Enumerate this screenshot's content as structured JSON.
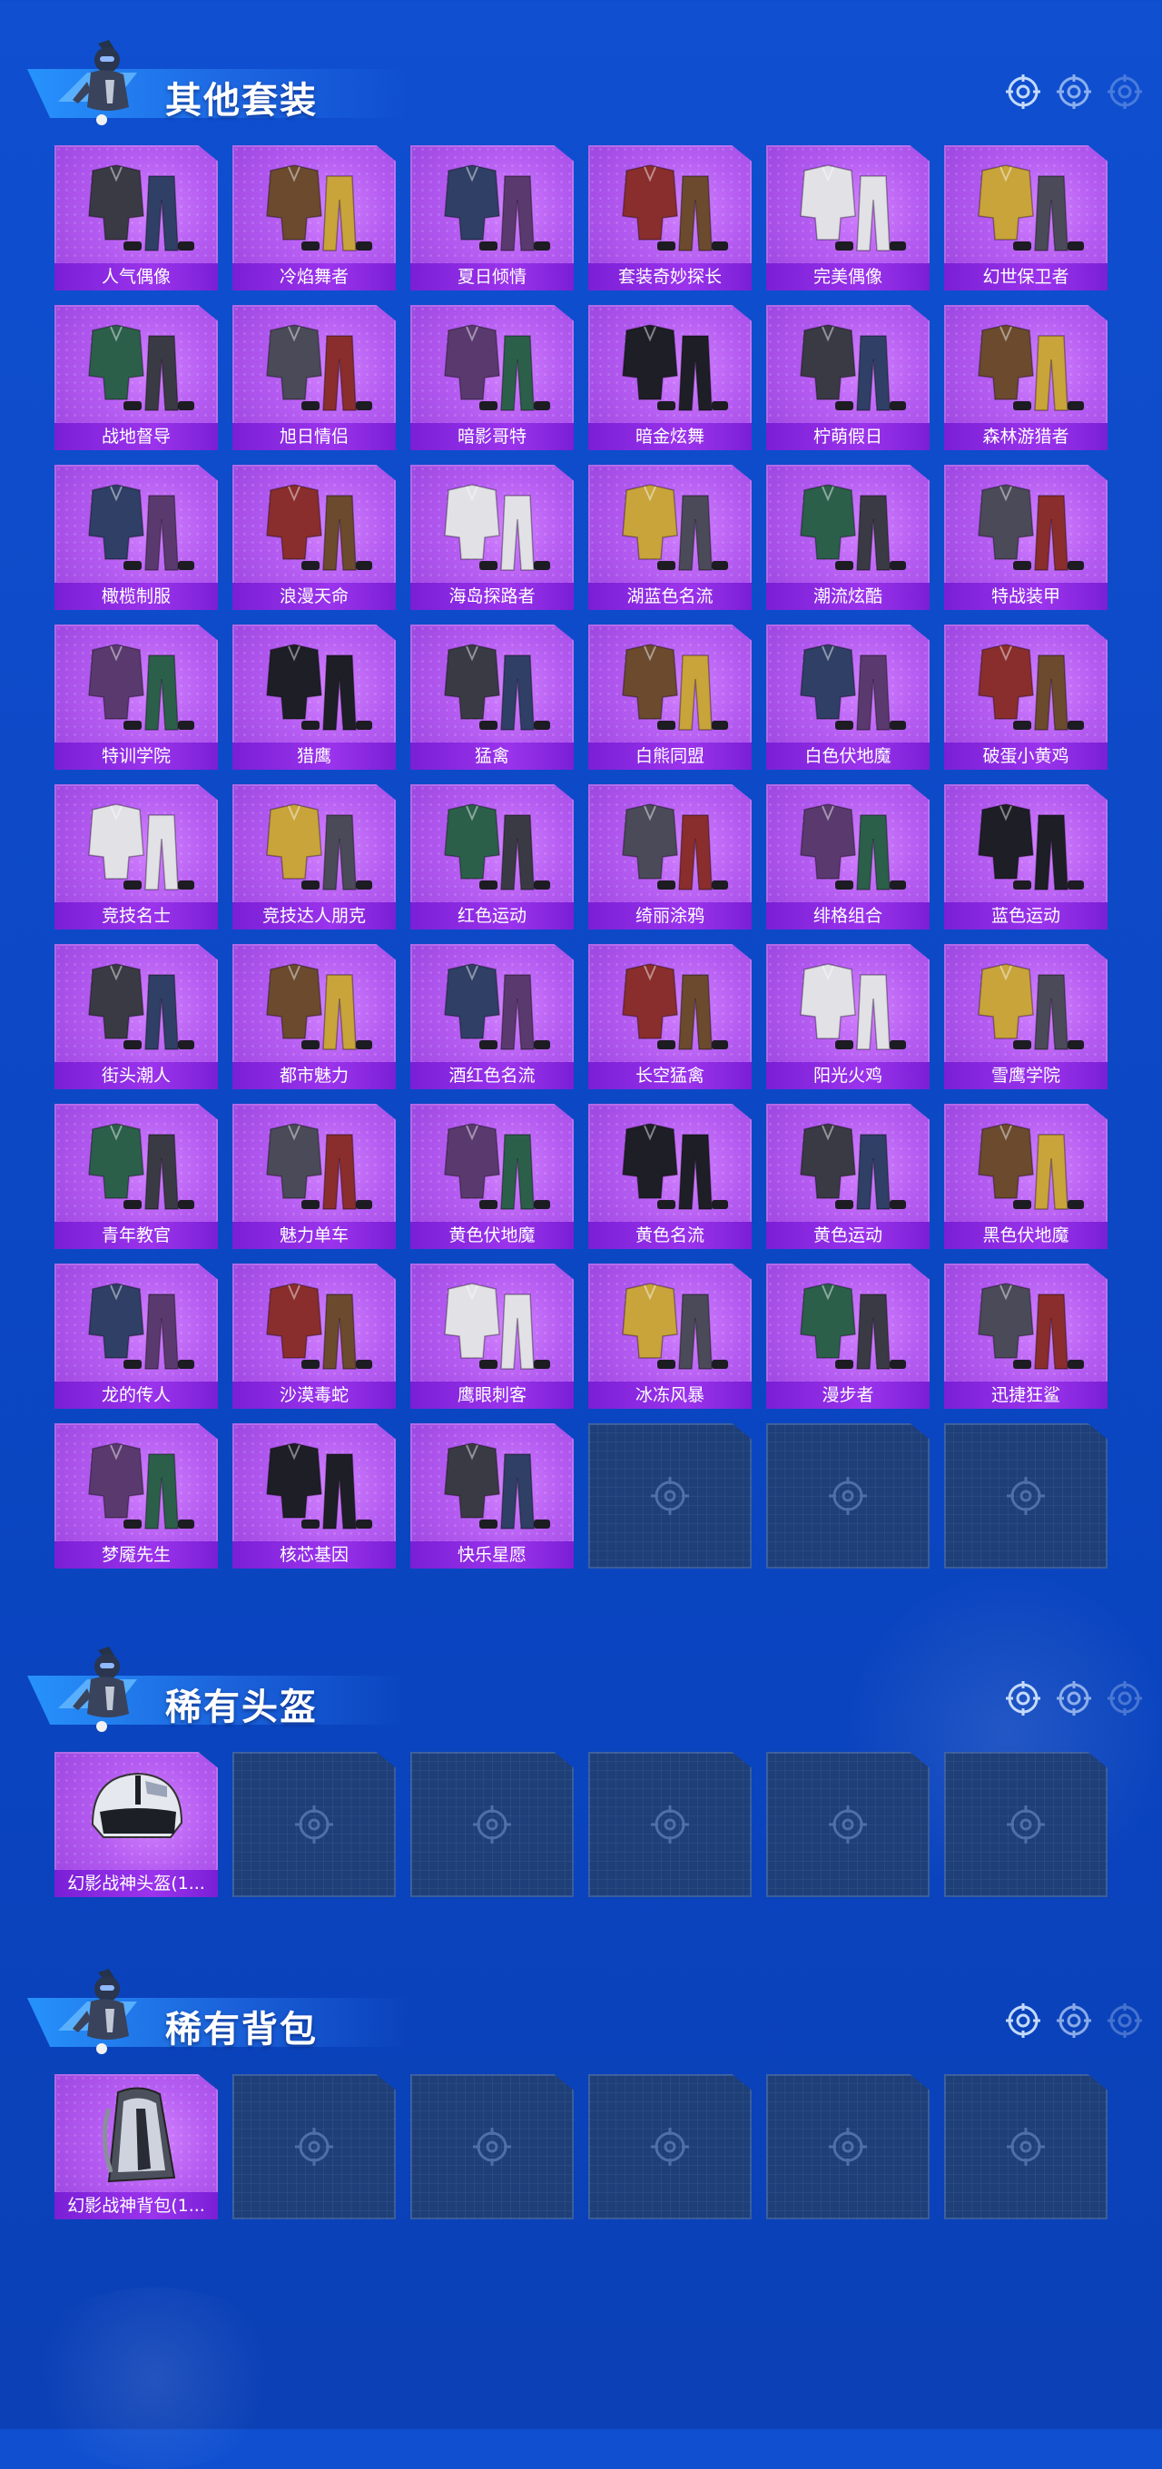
{
  "colors": {
    "page_bg": "#0d49c6",
    "card_bg": "#b45bf1",
    "label_bg": "#8a2ae3",
    "empty_bg": "#1e3f78"
  },
  "sections": [
    {
      "title": "其他套装",
      "items": [
        {
          "label": "人气偶像",
          "icon": "outfit"
        },
        {
          "label": "冷焰舞者",
          "icon": "outfit"
        },
        {
          "label": "夏日倾情",
          "icon": "outfit"
        },
        {
          "label": "套装奇妙探长",
          "icon": "outfit"
        },
        {
          "label": "完美偶像",
          "icon": "outfit"
        },
        {
          "label": "幻世保卫者",
          "icon": "outfit"
        },
        {
          "label": "战地督导",
          "icon": "outfit"
        },
        {
          "label": "旭日情侣",
          "icon": "outfit"
        },
        {
          "label": "暗影哥特",
          "icon": "outfit"
        },
        {
          "label": "暗金炫舞",
          "icon": "outfit"
        },
        {
          "label": "柠萌假日",
          "icon": "outfit"
        },
        {
          "label": "森林游猎者",
          "icon": "outfit"
        },
        {
          "label": "橄榄制服",
          "icon": "outfit"
        },
        {
          "label": "浪漫天命",
          "icon": "outfit"
        },
        {
          "label": "海岛探路者",
          "icon": "outfit"
        },
        {
          "label": "湖蓝色名流",
          "icon": "outfit"
        },
        {
          "label": "潮流炫酷",
          "icon": "outfit"
        },
        {
          "label": "特战装甲",
          "icon": "outfit"
        },
        {
          "label": "特训学院",
          "icon": "outfit"
        },
        {
          "label": "猎鹰",
          "icon": "outfit"
        },
        {
          "label": "猛禽",
          "icon": "outfit"
        },
        {
          "label": "白熊同盟",
          "icon": "outfit"
        },
        {
          "label": "白色伏地魔",
          "icon": "outfit"
        },
        {
          "label": "破蛋小黄鸡",
          "icon": "outfit"
        },
        {
          "label": "竞技名士",
          "icon": "outfit"
        },
        {
          "label": "竞技达人朋克",
          "icon": "outfit"
        },
        {
          "label": "红色运动",
          "icon": "outfit"
        },
        {
          "label": "绮丽涂鸦",
          "icon": "outfit"
        },
        {
          "label": "绯格组合",
          "icon": "outfit"
        },
        {
          "label": "蓝色运动",
          "icon": "outfit"
        },
        {
          "label": "街头潮人",
          "icon": "outfit"
        },
        {
          "label": "都市魅力",
          "icon": "outfit"
        },
        {
          "label": "酒红色名流",
          "icon": "outfit"
        },
        {
          "label": "长空猛禽",
          "icon": "outfit"
        },
        {
          "label": "阳光火鸡",
          "icon": "outfit"
        },
        {
          "label": "雪鹰学院",
          "icon": "outfit"
        },
        {
          "label": "青年教官",
          "icon": "outfit"
        },
        {
          "label": "魅力单车",
          "icon": "outfit"
        },
        {
          "label": "黄色伏地魔",
          "icon": "outfit"
        },
        {
          "label": "黄色名流",
          "icon": "outfit"
        },
        {
          "label": "黄色运动",
          "icon": "outfit"
        },
        {
          "label": "黑色伏地魔",
          "icon": "outfit"
        },
        {
          "label": "龙的传人",
          "icon": "outfit"
        },
        {
          "label": "沙漠毒蛇",
          "icon": "outfit"
        },
        {
          "label": "鹰眼刺客",
          "icon": "outfit"
        },
        {
          "label": "冰冻风暴",
          "icon": "outfit"
        },
        {
          "label": "漫步者",
          "icon": "outfit"
        },
        {
          "label": "迅捷狂鲨",
          "icon": "outfit"
        },
        {
          "label": "梦魇先生",
          "icon": "outfit"
        },
        {
          "label": "核芯基因",
          "icon": "outfit"
        },
        {
          "label": "快乐星愿",
          "icon": "outfit"
        }
      ],
      "empty_slots": 3
    },
    {
      "title": "稀有头盔",
      "items": [
        {
          "label": "幻影战神头盔(1...",
          "icon": "helmet"
        }
      ],
      "empty_slots": 5
    },
    {
      "title": "稀有背包",
      "items": [
        {
          "label": "幻影战神背包(1...",
          "icon": "backpack"
        }
      ],
      "empty_slots": 5
    }
  ]
}
